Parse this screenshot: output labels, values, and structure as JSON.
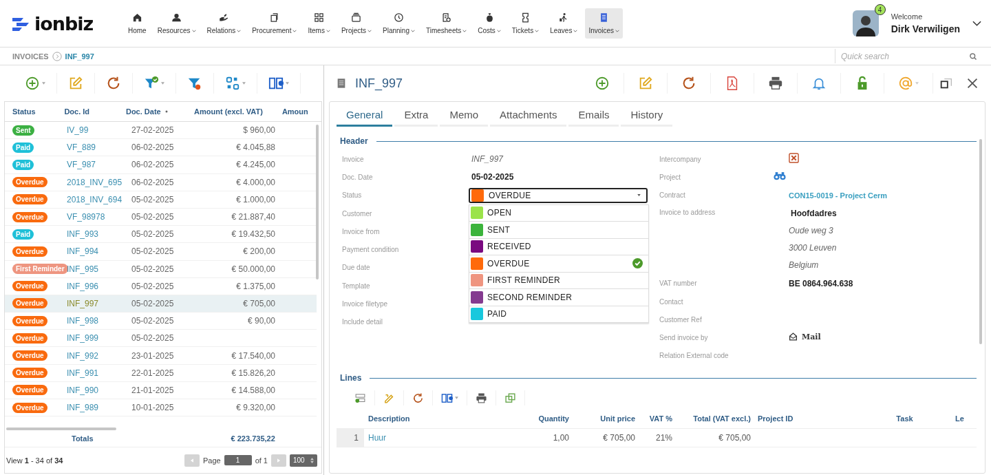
{
  "logo": "ionbiz",
  "nav": [
    {
      "label": "Home",
      "menu": false,
      "selected": false
    },
    {
      "label": "Resources",
      "menu": true,
      "selected": false
    },
    {
      "label": "Relations",
      "menu": true,
      "selected": false
    },
    {
      "label": "Procurement",
      "menu": true,
      "selected": false
    },
    {
      "label": "Items",
      "menu": true,
      "selected": false
    },
    {
      "label": "Projects",
      "menu": true,
      "selected": false
    },
    {
      "label": "Planning",
      "menu": true,
      "selected": false
    },
    {
      "label": "Timesheets",
      "menu": true,
      "selected": false
    },
    {
      "label": "Costs",
      "menu": true,
      "selected": false
    },
    {
      "label": "Tickets",
      "menu": true,
      "selected": false
    },
    {
      "label": "Leaves",
      "menu": true,
      "selected": false
    },
    {
      "label": "Invoices",
      "menu": true,
      "selected": true
    }
  ],
  "user": {
    "badge": "4",
    "welcome": "Welcome",
    "name": "Dirk Verwiligen"
  },
  "breadcrumb": [
    "INVOICES",
    "INF_997"
  ],
  "search": {
    "placeholder": "Quick search"
  },
  "grid": {
    "columns": [
      "Status",
      "Doc. Id",
      "Doc. Date",
      "Amount (excl. VAT)",
      "Amoun"
    ],
    "rows": [
      {
        "status": "Sent",
        "color": "#3cb043",
        "id": "IV_99",
        "date": "27-02-2025",
        "amount": "$ 960,00",
        "selected": false
      },
      {
        "status": "Paid",
        "color": "#1fc0d8",
        "id": "VF_889",
        "date": "06-02-2025",
        "amount": "€ 4.045,88",
        "selected": false
      },
      {
        "status": "Paid",
        "color": "#1fc0d8",
        "id": "VF_987",
        "date": "06-02-2025",
        "amount": "€ 4.245,00",
        "selected": false
      },
      {
        "status": "Overdue",
        "color": "#f96a0e",
        "id": "2018_INV_695",
        "date": "06-02-2025",
        "amount": "€ 4.000,00",
        "selected": false
      },
      {
        "status": "Overdue",
        "color": "#f96a0e",
        "id": "2018_INV_694",
        "date": "05-02-2025",
        "amount": "€ 1.000,00",
        "selected": false
      },
      {
        "status": "Overdue",
        "color": "#f96a0e",
        "id": "VF_98978",
        "date": "05-02-2025",
        "amount": "€ 21.887,40",
        "selected": false
      },
      {
        "status": "Paid",
        "color": "#1fc0d8",
        "id": "INF_993",
        "date": "05-02-2025",
        "amount": "€ 19.432,50",
        "selected": false
      },
      {
        "status": "Overdue",
        "color": "#f96a0e",
        "id": "INF_994",
        "date": "05-02-2025",
        "amount": "€ 200,00",
        "selected": false
      },
      {
        "status": "First Reminder",
        "color": "#ee9580",
        "id": "INF_995",
        "date": "05-02-2025",
        "amount": "€ 50.000,00",
        "selected": false
      },
      {
        "status": "Overdue",
        "color": "#f96a0e",
        "id": "INF_996",
        "date": "05-02-2025",
        "amount": "€ 1.375,00",
        "selected": false
      },
      {
        "status": "Overdue",
        "color": "#f96a0e",
        "id": "INF_997",
        "date": "05-02-2025",
        "amount": "€ 705,00",
        "selected": true
      },
      {
        "status": "Overdue",
        "color": "#f96a0e",
        "id": "INF_998",
        "date": "05-02-2025",
        "amount": "€ 90,00",
        "selected": false
      },
      {
        "status": "Overdue",
        "color": "#f96a0e",
        "id": "INF_999",
        "date": "05-02-2025",
        "selected": false
      },
      {
        "status": "Overdue",
        "color": "#f96a0e",
        "id": "INF_992",
        "date": "23-01-2025",
        "amount": "€ 17.540,00",
        "selected": false
      },
      {
        "status": "Overdue",
        "color": "#f96a0e",
        "id": "INF_991",
        "date": "22-01-2025",
        "amount": "€ 15.826,20",
        "selected": false
      },
      {
        "status": "Overdue",
        "color": "#f96a0e",
        "id": "INF_990",
        "date": "21-01-2025",
        "amount": "€ 14.588,00",
        "selected": false
      },
      {
        "status": "Overdue",
        "color": "#f96a0e",
        "id": "INF_989",
        "date": "10-01-2025",
        "amount": "€ 9.320,00",
        "selected": false
      }
    ],
    "totals": {
      "label": "Totals",
      "value": "€ 223.735,22"
    },
    "pager": {
      "view": "View **1** - 34 of **34**",
      "page_label": "Page",
      "page": "1",
      "of": "of 1",
      "per_page": "100"
    }
  },
  "detail": {
    "title": "INF_997",
    "tabs": [
      {
        "label": "General",
        "selected": true
      },
      {
        "label": "Extra",
        "selected": false
      },
      {
        "label": "Memo",
        "selected": false
      },
      {
        "label": "Attachments",
        "selected": false
      },
      {
        "label": "Emails",
        "selected": false
      },
      {
        "label": "History",
        "selected": false
      }
    ],
    "header_title": "Header",
    "form_left": [
      {
        "label": "Invoice",
        "kind": "italic",
        "value": "INF_997"
      },
      {
        "label": "Doc. Date",
        "kind": "bold",
        "value": "05-02-2025"
      },
      {
        "label": "Status",
        "kind": "select",
        "value": "OVERDUE",
        "color": "#ff6a0b",
        "expanded": true,
        "options": [
          {
            "label": "OPEN",
            "color": "#9be34a",
            "selected": false
          },
          {
            "label": "SENT",
            "color": "#3cb43c",
            "selected": false
          },
          {
            "label": "RECEIVED",
            "color": "#7a0a80",
            "selected": false
          },
          {
            "label": "OVERDUE",
            "color": "#ff6a0b",
            "selected": true
          },
          {
            "label": "FIRST REMINDER",
            "color": "#ef9580",
            "selected": false
          },
          {
            "label": "SECOND REMINDER",
            "color": "#843a8f",
            "selected": false
          },
          {
            "label": "PAID",
            "color": "#18c8dd",
            "selected": false
          }
        ]
      },
      {
        "label": "Customer",
        "kind": "plain"
      },
      {
        "label": "Invoice from",
        "kind": "plain"
      },
      {
        "label": "Payment condition",
        "kind": "plain"
      },
      {
        "label": "Due date",
        "kind": "plain"
      },
      {
        "label": "Template",
        "kind": "plain"
      },
      {
        "label": "Invoice filetype",
        "kind": "plain"
      },
      {
        "label": "Include detail",
        "kind": "plain"
      }
    ],
    "form_right": [
      {
        "label": "Intercompany",
        "kind": "flag",
        "checked": false
      },
      {
        "label": "Project",
        "kind": "lookup"
      },
      {
        "label": "Contract",
        "kind": "link",
        "value": "CON15-0019 - Project Cerm"
      },
      {
        "label": "Invoice to address",
        "kind": "address",
        "lines": [
          "Hoofdadres",
          "Oude weg 3",
          "3000 Leuven",
          "Belgium"
        ]
      },
      {
        "label": "VAT number",
        "kind": "bold",
        "value": "BE 0864.964.638"
      },
      {
        "label": "Contact",
        "kind": "plain"
      },
      {
        "label": "Customer Ref",
        "kind": "plain"
      },
      {
        "label": "Send invoice by",
        "kind": "mail",
        "value": "Mail"
      },
      {
        "label": "Relation External code",
        "kind": "plain"
      }
    ],
    "lines_title": "Lines",
    "lines": {
      "columns": [
        "Description",
        "Quantity",
        "Unit price",
        "VAT %",
        "Total (VAT excl.)",
        "Project ID",
        "Task",
        "Le"
      ],
      "rows": [
        {
          "number": "1",
          "description": "Huur",
          "quantity": "1,00",
          "unit_price": "€ 705,00",
          "vat": "21%",
          "total": "€ 705,00"
        }
      ]
    }
  }
}
